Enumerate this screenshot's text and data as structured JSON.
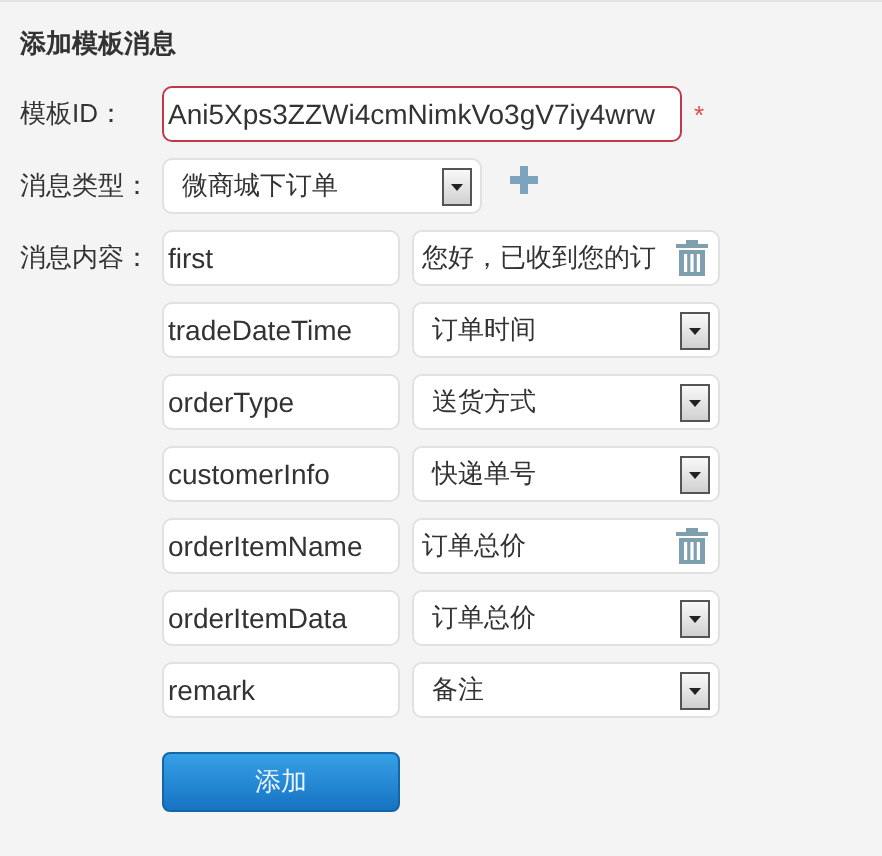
{
  "title": "添加模板消息",
  "template_id": {
    "label": "模板ID：",
    "value": "Ani5Xps3ZZWi4cmNimkVo3gV7iy4wrw",
    "invalid": true,
    "required_mark": "*"
  },
  "message_type": {
    "label": "消息类型：",
    "value": "微商城下订单"
  },
  "content": {
    "label": "消息内容：",
    "rows": [
      {
        "key": "first",
        "kind": "text",
        "value": "您好，已收到您的订"
      },
      {
        "key": "tradeDateTime",
        "kind": "select",
        "value": "订单时间"
      },
      {
        "key": "orderType",
        "kind": "select",
        "value": "送货方式"
      },
      {
        "key": "customerInfo",
        "kind": "select",
        "value": "快递单号"
      },
      {
        "key": "orderItemName",
        "kind": "text",
        "value": "订单总价"
      },
      {
        "key": "orderItemData",
        "kind": "select",
        "value": "订单总价"
      },
      {
        "key": "remark",
        "kind": "select",
        "value": "备注"
      }
    ]
  },
  "submit": "添加"
}
